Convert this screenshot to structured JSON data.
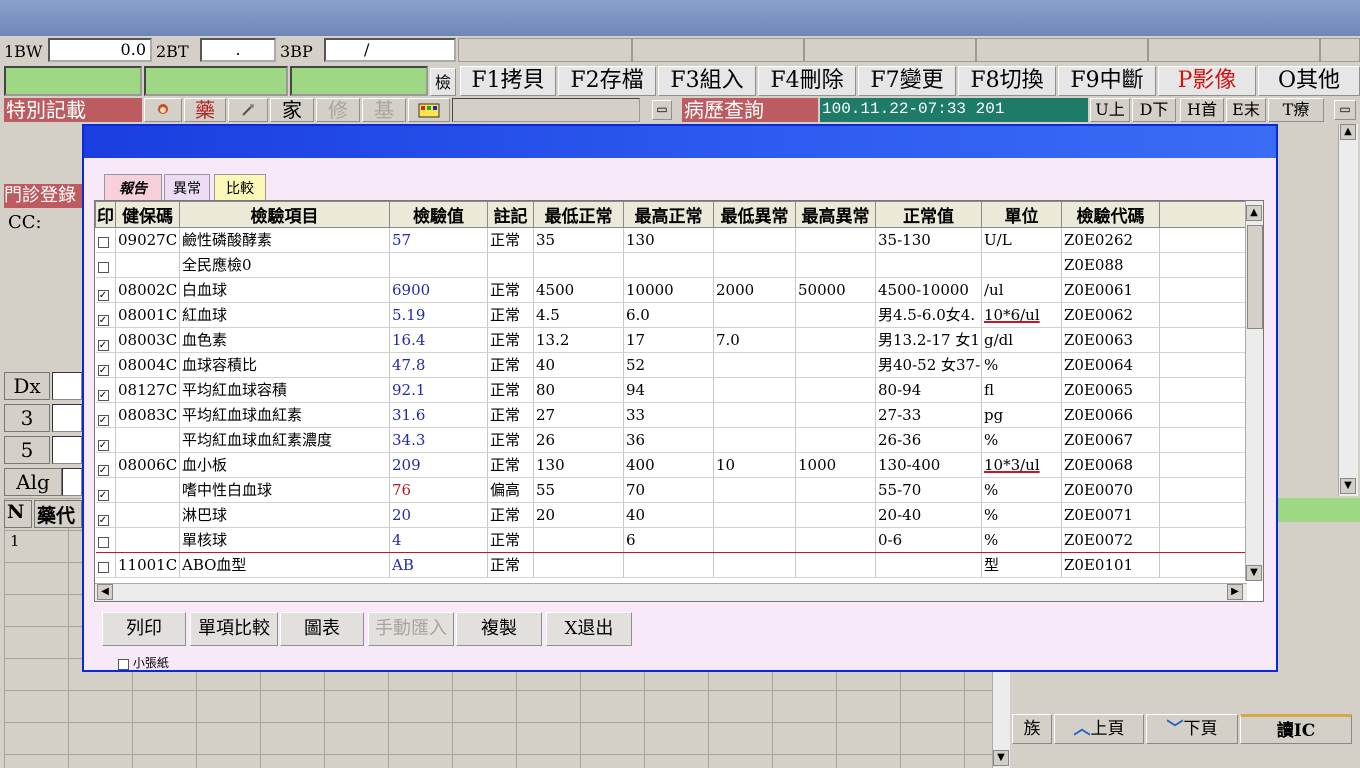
{
  "vitals": {
    "bw_label": "1BW",
    "bw_value": "0.0",
    "bt_label": "2BT",
    "bt_value": ".",
    "bp_label": "3BP",
    "bp_value": "/"
  },
  "fkeys": {
    "check_label": "檢",
    "f1": "F1拷貝",
    "f2": "F2存檔",
    "f3": "F3組入",
    "f4": "F4刪除",
    "f7": "F7變更",
    "f8": "F8切換",
    "f9": "F9中斷",
    "p": "P影像",
    "o": "O其他"
  },
  "toolbar": {
    "special_note": "特別記載",
    "medicine": "藥",
    "family": "家",
    "modify": "修",
    "base": "基",
    "history_query": "病歷查詢",
    "timestamp": "100.11.22-07:33 201",
    "nav_up": "U上",
    "nav_down": "D下",
    "nav_first": "H首",
    "nav_end": "E末",
    "nav_treat": "T療"
  },
  "left": {
    "clinic_reg": "門診登錄",
    "cc": "CC:",
    "dx": "Dx",
    "n3": "3",
    "n5": "5",
    "alg": "Alg",
    "col_n": "N",
    "col_drug": "藥代",
    "row1": "1"
  },
  "dialog": {
    "tabs": {
      "report": "報告",
      "abnormal": "異常",
      "compare": "比較"
    },
    "columns": [
      "印",
      "健保碼",
      "檢驗項目",
      "檢驗值",
      "註記",
      "最低正常",
      "最高正常",
      "最低異常",
      "最高異常",
      "正常值",
      "單位",
      "檢驗代碼"
    ],
    "rows": [
      {
        "checked": false,
        "code": "09027C",
        "item": "鹼性磷酸酵素",
        "value": "57",
        "note": "正常",
        "low_n": "35",
        "high_n": "130",
        "low_a": "",
        "high_a": "",
        "normal": "35-130",
        "unit": "U/L",
        "lab_code": "Z0E0262"
      },
      {
        "checked": false,
        "code": "",
        "item": "全民應檢0",
        "value": "",
        "note": "",
        "low_n": "",
        "high_n": "",
        "low_a": "",
        "high_a": "",
        "normal": "",
        "unit": "",
        "lab_code": "Z0E088"
      },
      {
        "checked": true,
        "code": "08002C",
        "item": "白血球",
        "value": "6900",
        "note": "正常",
        "low_n": "4500",
        "high_n": "10000",
        "low_a": "2000",
        "high_a": "50000",
        "normal": "4500-10000",
        "unit": "/ul",
        "lab_code": "Z0E0061"
      },
      {
        "checked": true,
        "code": "08001C",
        "item": "紅血球",
        "value": "5.19",
        "note": "正常",
        "low_n": "4.5",
        "high_n": "6.0",
        "low_a": "",
        "high_a": "",
        "normal": "男4.5-6.0女4.",
        "unit": "10*6/ul",
        "lab_code": "Z0E0062"
      },
      {
        "checked": true,
        "code": "08003C",
        "item": "血色素",
        "value": "16.4",
        "note": "正常",
        "low_n": "13.2",
        "high_n": "17",
        "low_a": "7.0",
        "high_a": "",
        "normal": "男13.2-17 女1",
        "unit": "g/dl",
        "lab_code": "Z0E0063"
      },
      {
        "checked": true,
        "code": "08004C",
        "item": "血球容積比",
        "value": "47.8",
        "note": "正常",
        "low_n": "40",
        "high_n": "52",
        "low_a": "",
        "high_a": "",
        "normal": "男40-52 女37-",
        "unit": "%",
        "lab_code": "Z0E0064"
      },
      {
        "checked": true,
        "code": "08127C",
        "item": "平均紅血球容積",
        "value": "92.1",
        "note": "正常",
        "low_n": "80",
        "high_n": "94",
        "low_a": "",
        "high_a": "",
        "normal": "80-94",
        "unit": "fl",
        "lab_code": "Z0E0065"
      },
      {
        "checked": true,
        "code": "08083C",
        "item": "平均紅血球血紅素",
        "value": "31.6",
        "note": "正常",
        "low_n": "27",
        "high_n": "33",
        "low_a": "",
        "high_a": "",
        "normal": "27-33",
        "unit": "pg",
        "lab_code": "Z0E0066"
      },
      {
        "checked": true,
        "code": "",
        "item": "平均紅血球血紅素濃度",
        "value": "34.3",
        "note": "正常",
        "low_n": "26",
        "high_n": "36",
        "low_a": "",
        "high_a": "",
        "normal": "26-36",
        "unit": "%",
        "lab_code": "Z0E0067"
      },
      {
        "checked": true,
        "code": "08006C",
        "item": "血小板",
        "value": "209",
        "note": "正常",
        "low_n": "130",
        "high_n": "400",
        "low_a": "10",
        "high_a": "1000",
        "normal": "130-400",
        "unit": "10*3/ul",
        "lab_code": "Z0E0068"
      },
      {
        "checked": true,
        "code": "",
        "item": "嗜中性白血球",
        "value": "76",
        "note": "偏高",
        "low_n": "55",
        "high_n": "70",
        "low_a": "",
        "high_a": "",
        "normal": "55-70",
        "unit": "%",
        "lab_code": "Z0E0070"
      },
      {
        "checked": true,
        "code": "",
        "item": "淋巴球",
        "value": "20",
        "note": "正常",
        "low_n": "20",
        "high_n": "40",
        "low_a": "",
        "high_a": "",
        "normal": "20-40",
        "unit": "%",
        "lab_code": "Z0E0071"
      },
      {
        "checked": false,
        "code": "",
        "item": "單核球",
        "value": "4",
        "note": "正常",
        "low_n": "",
        "high_n": "6",
        "low_a": "",
        "high_a": "",
        "normal": "0-6",
        "unit": "%",
        "lab_code": "Z0E0072"
      },
      {
        "checked": false,
        "code": "11001C",
        "item": "ABO血型",
        "value": "AB",
        "note": "正常",
        "low_n": "",
        "high_n": "",
        "low_a": "",
        "high_a": "",
        "normal": "",
        "unit": "型",
        "lab_code": "Z0E0101"
      }
    ],
    "buttons": {
      "print": "列印",
      "single_compare": "單項比較",
      "chart": "圖表",
      "manual_import": "手動匯入",
      "copy": "複製",
      "exit": "X退出"
    },
    "small_paper": "小張紙"
  },
  "bottom_bar": {
    "family": "族",
    "page_up": "上頁",
    "page_down": "下頁",
    "read_ic": "讀IC"
  }
}
